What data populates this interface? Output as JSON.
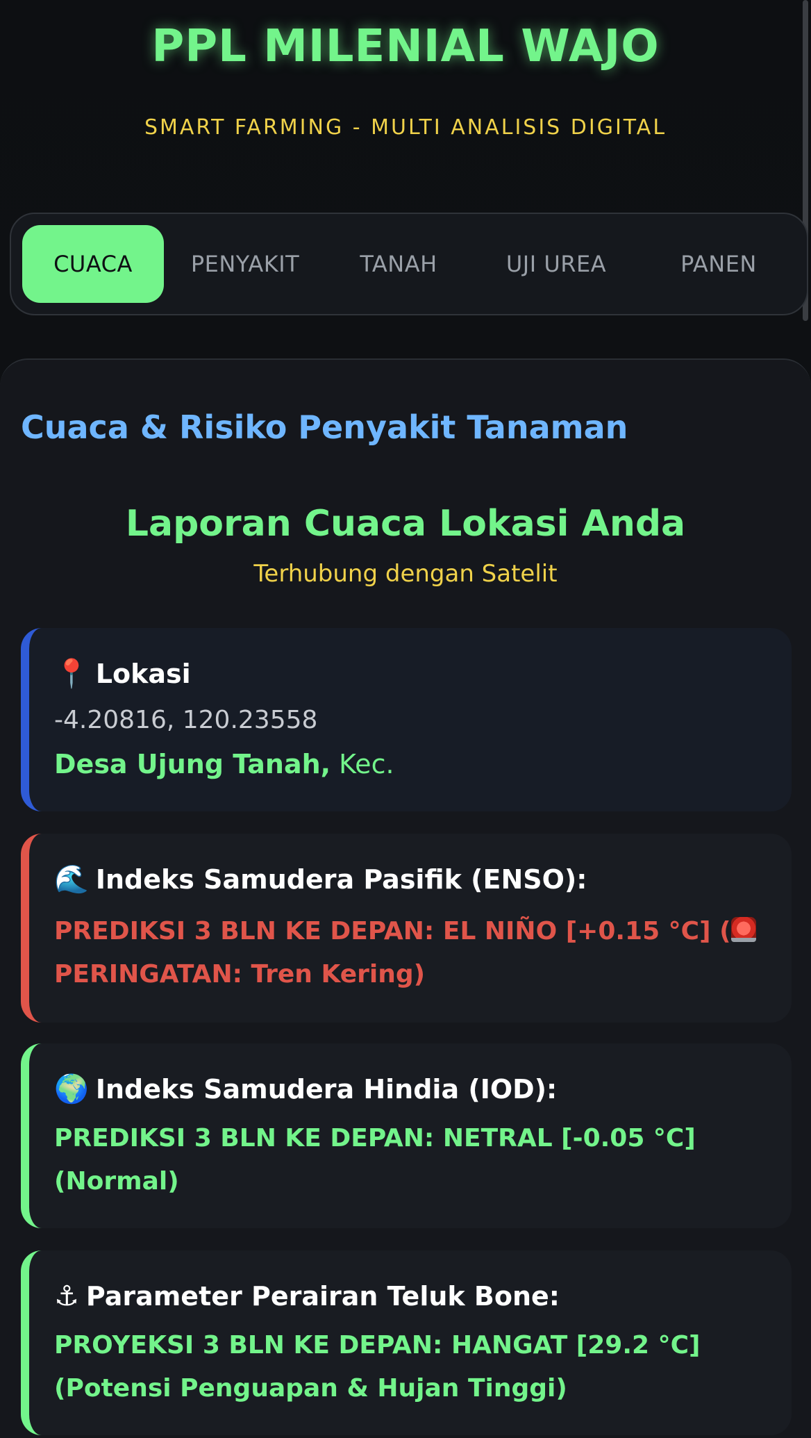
{
  "header": {
    "app_title": "PPL MILENIAL WAJO",
    "subtitle": "SMART FARMING - MULTI ANALISIS DIGITAL"
  },
  "tabs": [
    {
      "label": "CUACA",
      "active": true
    },
    {
      "label": "PENYAKIT",
      "active": false
    },
    {
      "label": "TANAH",
      "active": false
    },
    {
      "label": "UJI UREA",
      "active": false
    },
    {
      "label": "PANEN",
      "active": false
    }
  ],
  "main": {
    "section_title": "Cuaca & Risiko Penyakit Tanaman",
    "report_title": "Laporan Cuaca Lokasi Anda",
    "report_subtitle": "Terhubung dengan Satelit"
  },
  "cards": {
    "location": {
      "icon": "📍",
      "heading": "Lokasi",
      "coordinates": "-4.20816, 120.23558",
      "village": "Desa Ujung Tanah,",
      "district": " Kec.",
      "accent": "#2f5bd6"
    },
    "enso": {
      "icon": "🌊",
      "heading": "Indeks Samudera Pasifik (ENSO):",
      "text_before": "PREDIKSI 3 BLN KE DEPAN: EL NIÑO [+0.15 °C] (",
      "text_after": " PERINGATAN: Tren Kering)",
      "warning_icon": "siren-icon",
      "accent": "#e0554a"
    },
    "iod": {
      "icon": "🌍",
      "heading": "Indeks Samudera Hindia (IOD):",
      "text": "PREDIKSI 3 BLN KE DEPAN: NETRAL [-0.05 °C] (Normal)",
      "accent": "#73f48b"
    },
    "bone": {
      "icon": "⚓",
      "heading": "Parameter Perairan Teluk Bone:",
      "text": "PROYEKSI 3 BLN KE DEPAN: HANGAT [29.2 °C] (Potensi Penguapan & Hujan Tinggi)",
      "accent": "#73f48b"
    }
  }
}
